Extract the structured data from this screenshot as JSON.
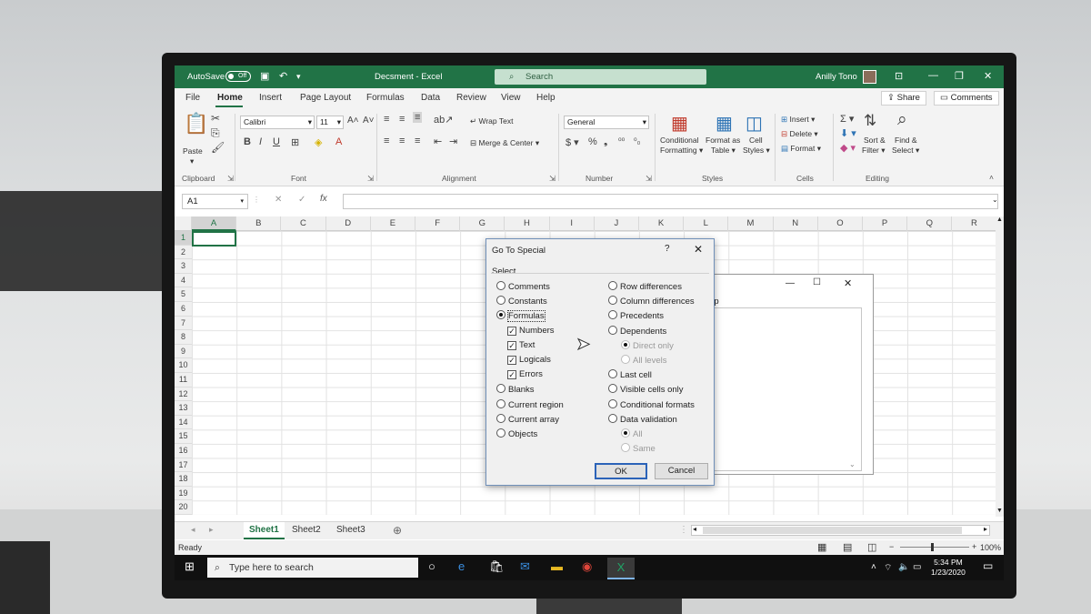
{
  "title_bar": {
    "autosave_label": "AutoSave",
    "autosave_state": "Off",
    "document_title": "Decsment - Excel",
    "search_placeholder": "Search",
    "user_name": "Anilly Tono"
  },
  "menu": {
    "items": [
      "File",
      "Home",
      "Insert",
      "Page Layout",
      "Formulas",
      "Data",
      "Review",
      "View",
      "Help"
    ],
    "share_label": "Share",
    "comments_label": "Comments"
  },
  "ribbon": {
    "clipboard": {
      "paste": "Paste",
      "group": "Clipboard"
    },
    "font": {
      "name": "Calibri",
      "size": "11",
      "group": "Font"
    },
    "alignment": {
      "wrap_text": "Wrap Text",
      "merge_center": "Merge & Center",
      "group": "Alignment"
    },
    "number": {
      "format": "General",
      "group": "Number"
    },
    "styles": {
      "conditional_1": "Conditional",
      "conditional_2": "Formatting ▾",
      "format_table_1": "Format as",
      "format_table_2": "Table ▾",
      "cell_styles_1": "Cell",
      "cell_styles_2": "Styles ▾",
      "group": "Styles"
    },
    "cells": {
      "insert": "Insert",
      "delete": "Delete",
      "format": "Format",
      "group": "Cells"
    },
    "editing": {
      "sort_1": "Sort &",
      "sort_2": "Filter ▾",
      "find_1": "Find &",
      "find_2": "Select ▾",
      "group": "Editing"
    }
  },
  "formula_bar": {
    "name_box": "A1",
    "fx": "fx",
    "value": ""
  },
  "grid": {
    "columns": [
      "A",
      "B",
      "C",
      "D",
      "E",
      "F",
      "G",
      "H",
      "I",
      "J",
      "K",
      "L",
      "M",
      "N",
      "O",
      "P",
      "Q",
      "R"
    ],
    "rows": [
      "1",
      "2",
      "3",
      "4",
      "5",
      "6",
      "7",
      "8",
      "9",
      "10",
      "11",
      "12",
      "13",
      "14",
      "15",
      "16",
      "17",
      "18",
      "19",
      "20"
    ],
    "selected_cell": "A1"
  },
  "sheets": {
    "tabs": [
      "Sheet1",
      "Sheet2",
      "Sheet3"
    ],
    "active": "Sheet1"
  },
  "status_bar": {
    "status": "Ready",
    "zoom": "100%"
  },
  "taskbar": {
    "search_placeholder": "Type here to search",
    "time": "5:34 PM",
    "date": "1/23/2020"
  },
  "background_dialog": {
    "menu_fragment": "elp"
  },
  "dialog": {
    "title": "Go To Special",
    "help": "?",
    "select_label": "Select",
    "left_options": [
      {
        "label": "Comments",
        "type": "radio",
        "checked": false
      },
      {
        "label": "Constants",
        "type": "radio",
        "checked": false
      },
      {
        "label": "Formulas",
        "type": "radio",
        "checked": true
      },
      {
        "label": "Numbers",
        "type": "checkbox",
        "checked": true
      },
      {
        "label": "Text",
        "type": "checkbox",
        "checked": true
      },
      {
        "label": "Logicals",
        "type": "checkbox",
        "checked": true
      },
      {
        "label": "Errors",
        "type": "checkbox",
        "checked": true
      },
      {
        "label": "Blanks",
        "type": "radio",
        "checked": false
      },
      {
        "label": "Current region",
        "type": "radio",
        "checked": false
      },
      {
        "label": "Current array",
        "type": "radio",
        "checked": false
      },
      {
        "label": "Objects",
        "type": "radio",
        "checked": false
      }
    ],
    "right_options": [
      {
        "label": "Row differences",
        "type": "radio",
        "checked": false,
        "disabled": false
      },
      {
        "label": "Column differences",
        "type": "radio",
        "checked": false,
        "disabled": false
      },
      {
        "label": "Precedents",
        "type": "radio",
        "checked": false,
        "disabled": false
      },
      {
        "label": "Dependents",
        "type": "radio",
        "checked": false,
        "disabled": false
      },
      {
        "label": "Direct only",
        "type": "radio",
        "checked": true,
        "disabled": true
      },
      {
        "label": "All levels",
        "type": "radio",
        "checked": false,
        "disabled": true
      },
      {
        "label": "Last cell",
        "type": "radio",
        "checked": false,
        "disabled": false
      },
      {
        "label": "Visible cells only",
        "type": "radio",
        "checked": false,
        "disabled": false
      },
      {
        "label": "Conditional formats",
        "type": "radio",
        "checked": false,
        "disabled": false
      },
      {
        "label": "Data validation",
        "type": "radio",
        "checked": false,
        "disabled": false
      },
      {
        "label": "All",
        "type": "radio",
        "checked": true,
        "disabled": true
      },
      {
        "label": "Same",
        "type": "radio",
        "checked": false,
        "disabled": true
      }
    ],
    "ok_label": "OK",
    "cancel_label": "Cancel"
  },
  "colors": {
    "excel_green": "#217346",
    "search_bg": "#c6e0cf",
    "taskbar": "#101010"
  }
}
